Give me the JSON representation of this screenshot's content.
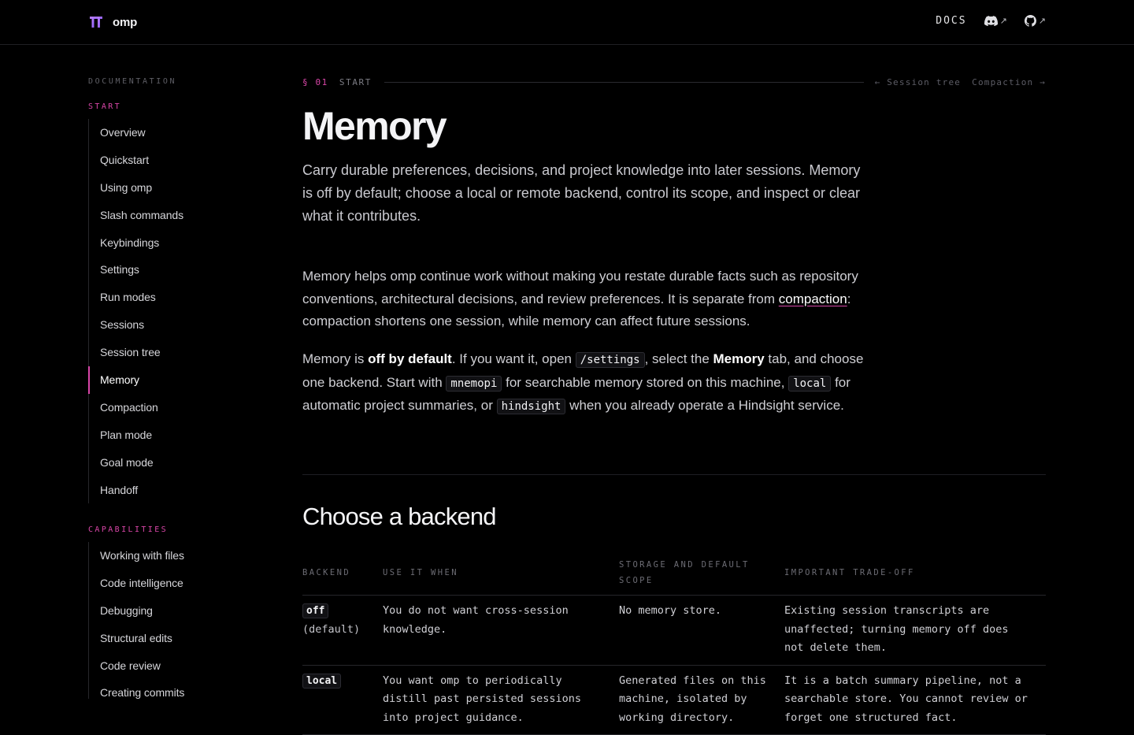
{
  "header": {
    "brand": "omp",
    "docs_label": "DOCS",
    "discord_arrow": "↗",
    "github_arrow": "↗"
  },
  "sidebar": {
    "heading": "DOCUMENTATION",
    "sections": [
      {
        "title": "START",
        "items": [
          "Overview",
          "Quickstart",
          "Using omp",
          "Slash commands",
          "Keybindings",
          "Settings",
          "Run modes",
          "Sessions",
          "Session tree",
          "Memory",
          "Compaction",
          "Plan mode",
          "Goal mode",
          "Handoff"
        ]
      },
      {
        "title": "CAPABILITIES",
        "items": [
          "Working with files",
          "Code intelligence",
          "Debugging",
          "Structural edits",
          "Code review",
          "Creating commits"
        ]
      }
    ],
    "active_item": "Memory"
  },
  "crumb": {
    "number": "§ 01",
    "section": "START",
    "prev": "← Session tree",
    "next": "Compaction →"
  },
  "page": {
    "title": "Memory",
    "lede": "Carry durable preferences, decisions, and project knowledge into later sessions. Memory is off by default; choose a local or remote backend, control its scope, and inspect or clear what it contributes.",
    "p1": {
      "before": "Memory helps omp continue work without making you restate durable facts such as repository conventions, architectural decisions, and review preferences. It is separate from ",
      "link": "compaction",
      "after": ": compaction shortens one session, while memory can affect future sessions."
    },
    "p2": {
      "t1": "Memory is ",
      "b1": "off by default",
      "t2": ". If you want it, open ",
      "c1": "/settings",
      "t3": ", select the ",
      "b2": "Memory",
      "t4": " tab, and choose one backend. Start with ",
      "c2": "mnemopi",
      "t5": " for searchable memory stored on this machine, ",
      "c3": "local",
      "t6": " for automatic project summaries, or ",
      "c4": "hindsight",
      "t7": " when you already operate a Hindsight service."
    },
    "section_title": "Choose a backend"
  },
  "table": {
    "headers": [
      "BACKEND",
      "USE IT WHEN",
      "STORAGE AND DEFAULT SCOPE",
      "IMPORTANT TRADE-OFF"
    ],
    "rows": [
      {
        "backend": "off",
        "backend_note": "(default)",
        "use_when": "You do not want cross-session knowledge.",
        "storage": "No memory store.",
        "tradeoff": "Existing session transcripts are unaffected; turning memory off does not delete them."
      },
      {
        "backend": "local",
        "backend_note": "",
        "use_when": "You want omp to periodically distill past persisted sessions into project guidance.",
        "storage": "Generated files on this machine, isolated by working directory.",
        "tradeoff": "It is a batch summary pipeline, not a searchable store. You cannot review or forget one structured fact."
      }
    ]
  }
}
